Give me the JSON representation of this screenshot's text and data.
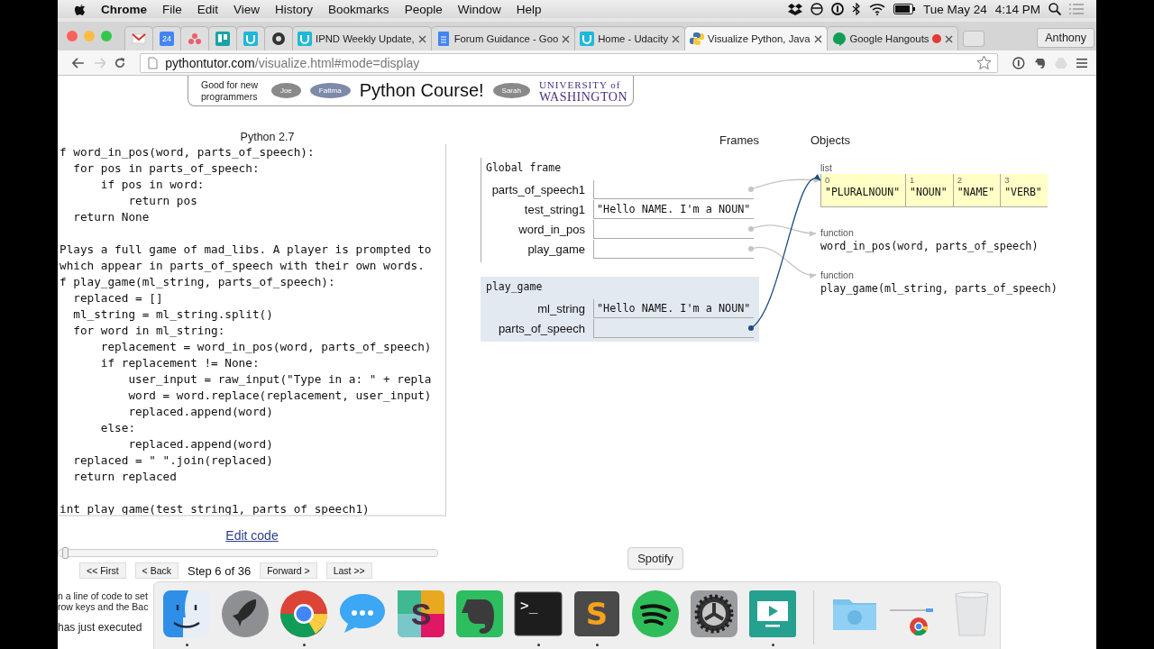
{
  "menubar": {
    "app": "Chrome",
    "menus": [
      "File",
      "Edit",
      "View",
      "History",
      "Bookmarks",
      "People",
      "Window",
      "Help"
    ],
    "date": "Tue May 24",
    "time": "4:14 PM"
  },
  "tabs": [
    {
      "kind": "mail",
      "selected": false
    },
    {
      "kind": "calendar",
      "icon_text": "24",
      "selected": false
    },
    {
      "kind": "dots",
      "selected": false
    },
    {
      "kind": "board",
      "selected": false
    },
    {
      "kind": "udacity",
      "selected": false
    },
    {
      "kind": "disc",
      "selected": false
    },
    {
      "kind": "udacity",
      "title": "IPND Weekly Update,",
      "selected": false
    },
    {
      "kind": "doc",
      "title": "Forum Guidance - Goo",
      "selected": false
    },
    {
      "kind": "udacity",
      "title": "Home - Udacity",
      "selected": false
    },
    {
      "kind": "python",
      "title": "Visualize Python, Java",
      "selected": true
    },
    {
      "kind": "chat",
      "title": "Google Hangouts",
      "recording": true,
      "selected": false
    }
  ],
  "profile": "Anthony",
  "address": {
    "host": "pythontutor.com",
    "path": "/visualize.html#mode=display"
  },
  "banner": {
    "tagline": "Good for new programmers",
    "bubbles": [
      "Joe",
      "Fattma",
      "Sarah"
    ],
    "title": "Python Course!",
    "university_line1": "UNIVERSITY of",
    "university_line2": "WASHINGTON"
  },
  "code": {
    "language": "Python 2.7",
    "lines": [
      {
        "kind": "code",
        "text": "f word_in_pos(word, parts_of_speech):"
      },
      {
        "kind": "code",
        "text": "  for pos in parts_of_speech:"
      },
      {
        "kind": "code",
        "text": "      if pos in word:"
      },
      {
        "kind": "code",
        "text": "          return pos"
      },
      {
        "kind": "code",
        "text": "  return None"
      },
      {
        "kind": "blank"
      },
      {
        "kind": "code",
        "text": "Plays a full game of mad_libs. A player is prompted to"
      },
      {
        "kind": "code",
        "text": "which appear in parts_of_speech with their own words."
      },
      {
        "kind": "code",
        "text": "f play_game(ml_string, parts_of_speech):"
      },
      {
        "kind": "code",
        "text": "  replaced = []"
      },
      {
        "kind": "code",
        "text": "  ml_string = ml_string.split()"
      },
      {
        "kind": "code",
        "text": "  for word in ml_string:"
      },
      {
        "kind": "code",
        "text": "      replacement = word_in_pos(word, parts_of_speech)"
      },
      {
        "kind": "code",
        "text": "      if replacement != None:"
      },
      {
        "kind": "code",
        "text": "          user_input = raw_input(\"Type in a: \" + repla"
      },
      {
        "kind": "code",
        "text": "          word = word.replace(replacement, user_input)"
      },
      {
        "kind": "code",
        "text": "          replaced.append(word)"
      },
      {
        "kind": "code",
        "text": "      else:"
      },
      {
        "kind": "code",
        "text": "          replaced.append(word)"
      },
      {
        "kind": "code",
        "text": "  replaced = \" \".join(replaced)"
      },
      {
        "kind": "code",
        "text": "  return replaced"
      },
      {
        "kind": "blank"
      },
      {
        "kind": "code",
        "text": "int play_game(test_string1, parts_of_speech1)"
      }
    ],
    "edit_link": "Edit code",
    "slider": {
      "level": 0.01
    },
    "nav": [
      {
        "kind": "button",
        "label": "<< First"
      },
      {
        "kind": "button",
        "label": "< Back"
      },
      {
        "kind": "status",
        "label": "Step 6 of 36"
      },
      {
        "kind": "button",
        "label": "Forward >"
      },
      {
        "kind": "button",
        "label": "Last >>"
      }
    ],
    "help_fragments": [
      "n a line of code to set",
      "row keys and the Bac",
      "has just executed"
    ]
  },
  "frames_heading": "Frames",
  "objects_heading": "Objects",
  "frames": [
    {
      "name": "Global frame",
      "active": false,
      "vars": [
        {
          "name": "parts_of_speech1",
          "kind": "pointer"
        },
        {
          "name": "test_string1",
          "kind": "string",
          "value": "\"Hello NAME. I'm a NOUN\""
        },
        {
          "name": "word_in_pos",
          "kind": "pointer"
        },
        {
          "name": "play_game",
          "kind": "pointer"
        }
      ]
    },
    {
      "name": "play_game",
      "active": true,
      "vars": [
        {
          "name": "ml_string",
          "kind": "string",
          "value": "\"Hello NAME. I'm a NOUN\""
        },
        {
          "name": "parts_of_speech",
          "kind": "pointer"
        }
      ]
    }
  ],
  "objects": [
    {
      "kind": "list",
      "type_label": "list",
      "items": [
        {
          "index": "0",
          "value": "\"PLURALNOUN\""
        },
        {
          "index": "1",
          "value": "\"NOUN\""
        },
        {
          "index": "2",
          "value": "\"NAME\""
        },
        {
          "index": "3",
          "value": "\"VERB\""
        }
      ]
    },
    {
      "kind": "function",
      "type_label": "function",
      "signature": "word_in_pos(word, parts_of_speech)"
    },
    {
      "kind": "function",
      "type_label": "function",
      "signature": "play_game(ml_string, parts_of_speech)"
    }
  ],
  "dock": {
    "items": [
      {
        "kind": "finder",
        "running": true
      },
      {
        "kind": "rocket",
        "running": false
      },
      {
        "kind": "browser",
        "running": true
      },
      {
        "kind": "messages",
        "running": false
      },
      {
        "kind": "slack",
        "glyph": "S",
        "running": false
      },
      {
        "kind": "elephant",
        "running": false
      },
      {
        "kind": "terminal",
        "glyph": ">_",
        "running": true
      },
      {
        "kind": "sublime",
        "glyph": "S",
        "running": true
      },
      {
        "kind": "spotify",
        "tooltip": "Spotify",
        "running": false
      },
      {
        "kind": "settings",
        "running": false
      },
      {
        "kind": "screen",
        "running": true
      }
    ],
    "stacks": [
      {
        "kind": "folder"
      },
      {
        "kind": "downloads"
      },
      {
        "kind": "trash"
      }
    ]
  }
}
